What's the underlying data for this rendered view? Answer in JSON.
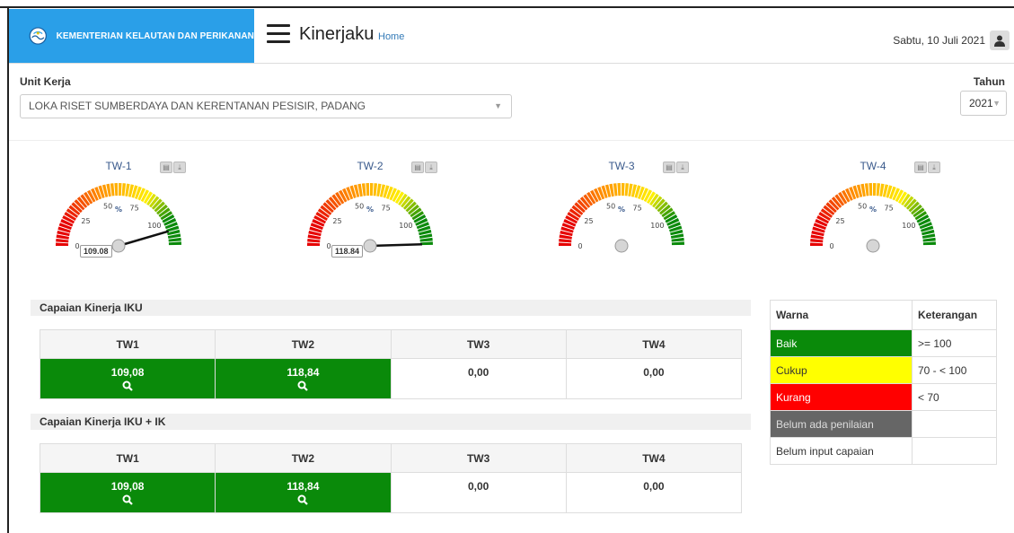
{
  "header": {
    "brand_text": "KEMENTERIAN KELAUTAN DAN PERIKANAN",
    "app_title": "Kinerjaku",
    "home_link": "Home",
    "date": "Sabtu, 10 Juli 2021"
  },
  "filters": {
    "unit_label": "Unit Kerja",
    "unit_value": "LOKA RISET SUMBERDAYA DAN KERENTANAN PESISIR, PADANG",
    "tahun_label": "Tahun",
    "tahun_value": "2021"
  },
  "gauges": [
    {
      "title": "TW-1",
      "value": 109.08,
      "value_label": "109.08"
    },
    {
      "title": "TW-2",
      "value": 118.84,
      "value_label": "118.84"
    },
    {
      "title": "TW-3",
      "value": 0,
      "value_label": ""
    },
    {
      "title": "TW-4",
      "value": 0,
      "value_label": ""
    }
  ],
  "gauge_ticks": {
    "t0": "0",
    "t25": "25",
    "t50": "50",
    "t75": "75",
    "t100": "100",
    "unit": "%"
  },
  "iku": {
    "title": "Capaian Kinerja IKU",
    "headers": [
      "TW1",
      "TW2",
      "TW3",
      "TW4"
    ],
    "values": [
      "109,08",
      "118,84",
      "0,00",
      "0,00"
    ]
  },
  "iku_ik": {
    "title": "Capaian Kinerja IKU + IK",
    "headers": [
      "TW1",
      "TW2",
      "TW3",
      "TW4"
    ],
    "values": [
      "109,08",
      "118,84",
      "0,00",
      "0,00"
    ]
  },
  "legend": {
    "col_warna": "Warna",
    "col_keterangan": "Keterangan",
    "rows": [
      {
        "label": "Baik",
        "desc": ">= 100",
        "color": "#0a8a0a"
      },
      {
        "label": "Cukup",
        "desc": "70 - < 100",
        "color": "#ffff00"
      },
      {
        "label": "Kurang",
        "desc": "< 70",
        "color": "#ff0000"
      },
      {
        "label": "Belum ada penilaian",
        "desc": "",
        "color": "#666666"
      },
      {
        "label": "Belum input capaian",
        "desc": "",
        "color": "#ffffff"
      }
    ]
  },
  "colors": {
    "brand": "#2a9fe8",
    "good": "#0a8a0a"
  }
}
